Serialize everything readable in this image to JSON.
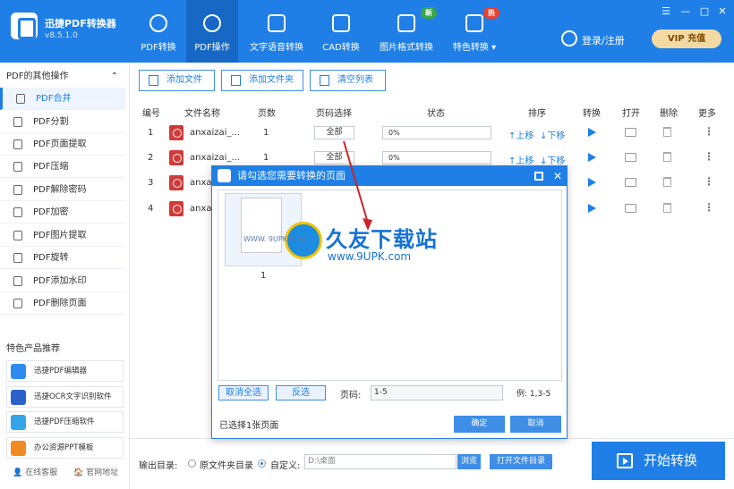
{
  "app": {
    "name": "迅捷PDF转换器",
    "version": "v8.5.1.0"
  },
  "nav": [
    {
      "label": "PDF转换",
      "active": false
    },
    {
      "label": "PDF操作",
      "active": true
    },
    {
      "label": "文字语音转换",
      "active": false
    },
    {
      "label": "CAD转换",
      "active": false
    },
    {
      "label": "图片格式转换",
      "active": false,
      "badge": "新"
    },
    {
      "label": "特色转换 ▾",
      "active": false,
      "badge": "热"
    }
  ],
  "header": {
    "login": "登录/注册",
    "vip": "VIP 充值",
    "menu": "☰",
    "minimize": "—",
    "maximize": "□",
    "close": "✕"
  },
  "sidebar": {
    "title": "PDF的其他操作",
    "collapse": "⌃",
    "items": [
      "PDF合并",
      "PDF分割",
      "PDF页面提取",
      "PDF压缩",
      "PDF解除密码",
      "PDF加密",
      "PDF图片提取",
      "PDF旋转",
      "PDF添加水印",
      "PDF删除页面"
    ],
    "active_index": 0,
    "reco_title": "特色产品推荐",
    "reco": [
      "迅捷PDF编辑器",
      "迅捷OCR文字识别软件",
      "迅捷PDF压缩软件",
      "办公资源PPT模板"
    ],
    "service": "在线客服",
    "website": "官网地址"
  },
  "toolbar": {
    "add_file": "添加文件",
    "add_folder": "添加文件夹",
    "clear": "清空列表"
  },
  "table": {
    "headers": [
      "编号",
      "文件名称",
      "页数",
      "页码选择",
      "状态",
      "排序",
      "转换",
      "打开",
      "删除",
      "更多"
    ],
    "rows": [
      {
        "num": "1",
        "name": "anxaizai_...",
        "pages": "1",
        "range": "全部",
        "status": "0%"
      },
      {
        "num": "2",
        "name": "anxaizai_...",
        "pages": "1",
        "range": "全部",
        "status": "0%"
      },
      {
        "num": "3",
        "name": "anxa"
      },
      {
        "num": "4",
        "name": "anxa"
      }
    ],
    "up": "↑上移",
    "down": "↓下移",
    "more": "⋮"
  },
  "output": {
    "label": "输出目录:",
    "opt_source": "原文件夹目录",
    "opt_custom": "自定义:",
    "path": "D:\\桌面",
    "browse": "浏览",
    "open_dir": "打开文件目录",
    "selected": "custom"
  },
  "start": {
    "label": "开始转换"
  },
  "dialog": {
    "title": "请勾选您需要转换的页面",
    "page_label": "1",
    "cancel_all": "取消全选",
    "invert": "反选",
    "page_code_label": "页码:",
    "page_code_value": "1-5",
    "example": "例: 1,3-5",
    "status": "已选择1张页面",
    "ok": "确定",
    "cancel": "取消"
  },
  "watermark": {
    "cn": "久友下载站",
    "url": "www.9UPK.com",
    "prefix": "WWW. 9UPK.Com"
  },
  "colors": {
    "primary": "#1f7fe6",
    "badge_new": "#3aa74a",
    "badge_hot": "#e8412f",
    "pdf_red": "#d23a3a"
  }
}
